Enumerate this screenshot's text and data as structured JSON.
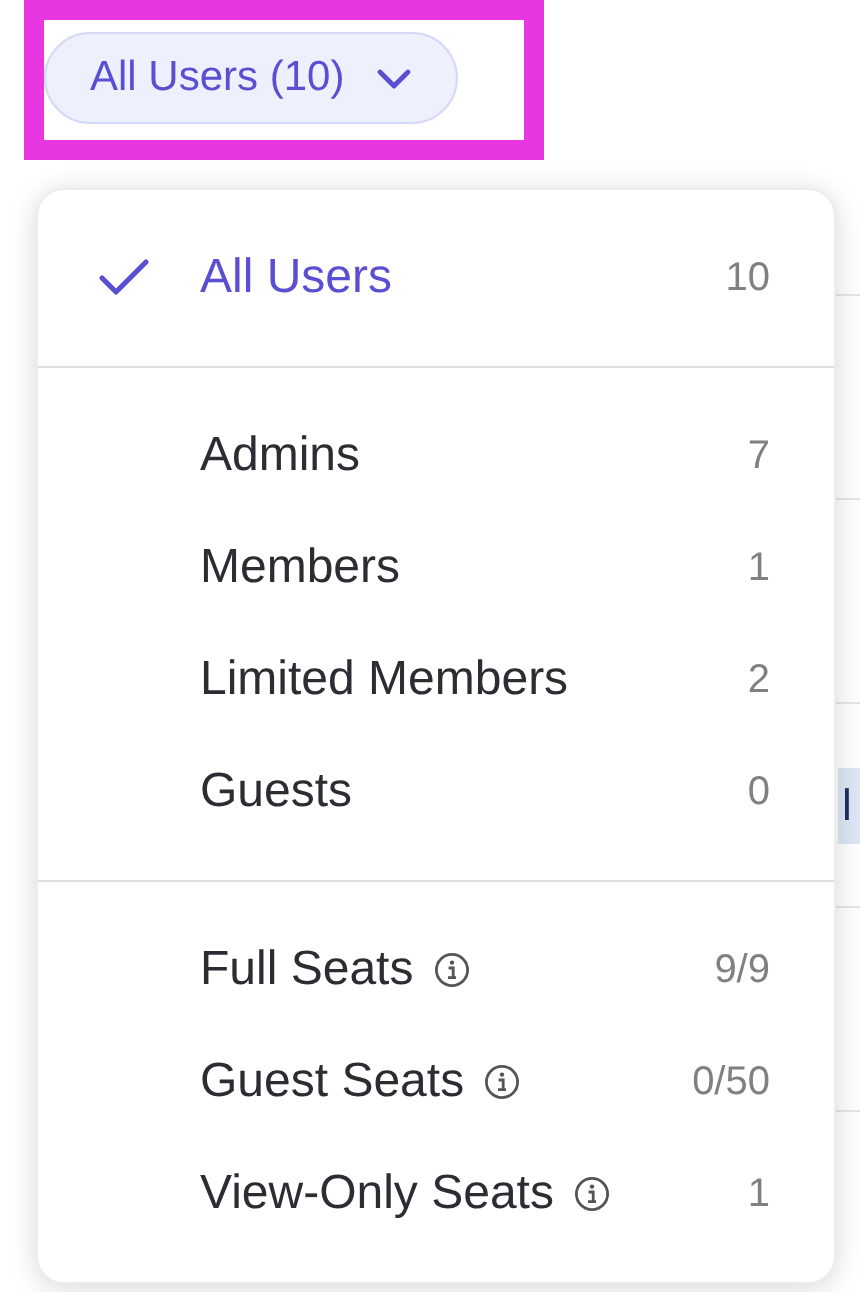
{
  "filter_button": {
    "label": "All Users (10)"
  },
  "menu": {
    "sections": [
      {
        "items": [
          {
            "label": "All Users",
            "count": "10",
            "selected": true,
            "info": false
          }
        ]
      },
      {
        "items": [
          {
            "label": "Admins",
            "count": "7",
            "selected": false,
            "info": false
          },
          {
            "label": "Members",
            "count": "1",
            "selected": false,
            "info": false
          },
          {
            "label": "Limited Members",
            "count": "2",
            "selected": false,
            "info": false
          },
          {
            "label": "Guests",
            "count": "0",
            "selected": false,
            "info": false
          }
        ]
      },
      {
        "items": [
          {
            "label": "Full Seats",
            "count": "9/9",
            "selected": false,
            "info": true
          },
          {
            "label": "Guest Seats",
            "count": "0/50",
            "selected": false,
            "info": true
          },
          {
            "label": "View-Only Seats",
            "count": "1",
            "selected": false,
            "info": true
          }
        ]
      }
    ]
  },
  "background": {
    "tag": "l"
  }
}
